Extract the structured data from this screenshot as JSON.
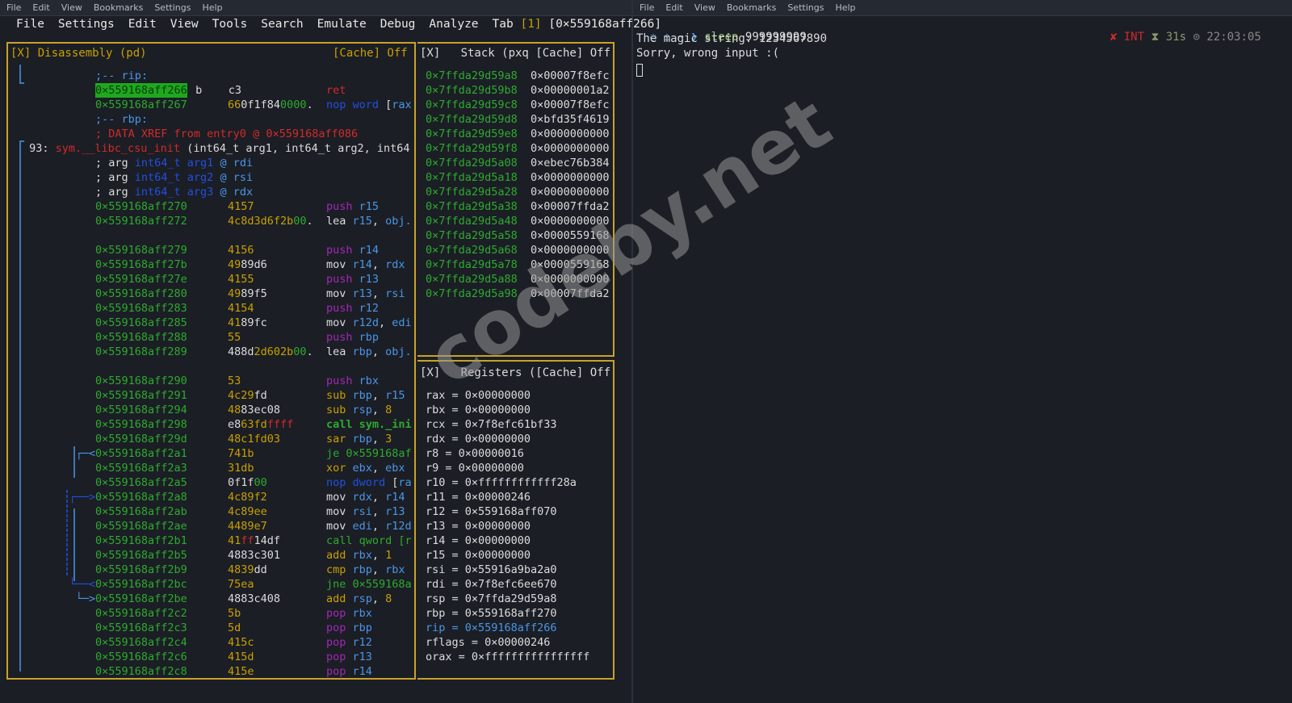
{
  "left_window": {
    "menu": [
      "File",
      "Edit",
      "View",
      "Bookmarks",
      "Settings",
      "Help"
    ]
  },
  "right_window": {
    "menu": [
      "File",
      "Edit",
      "View",
      "Bookmarks",
      "Settings",
      "Help"
    ]
  },
  "r2_menu": {
    "items": [
      "File",
      "Settings",
      "Edit",
      "View",
      "Tools",
      "Search",
      "Emulate",
      "Debug",
      "Analyze"
    ],
    "tab_label": "Tab",
    "tab_num": "[1]",
    "address": "[0×559168aff266]"
  },
  "disasm": {
    "title": "[X] Disassembly (pd)",
    "cache": "[Cache] Off",
    "rows": [
      {
        "c": [
          [
            ";-- rip:",
            "b"
          ]
        ]
      },
      {
        "addr": "0×559168aff266",
        "hl": true,
        "b": [
          [
            " b    c3",
            "w"
          ]
        ],
        "o": [
          [
            "ret",
            "r"
          ]
        ]
      },
      {
        "addr": "0×559168aff267",
        "b": [
          [
            "66",
            "y"
          ],
          [
            "0f1f84",
            "w"
          ],
          [
            "0000",
            "g"
          ],
          [
            ".",
            "w"
          ]
        ],
        "o": [
          [
            "nop word",
            "d"
          ],
          [
            " [",
            "w"
          ],
          [
            "rax",
            "b"
          ]
        ]
      },
      {
        "c": [
          [
            ";-- rbp:",
            "b"
          ]
        ]
      },
      {
        "c": [
          [
            "; DATA XREF from entry0 @ 0×559168aff086",
            "r"
          ]
        ]
      },
      {
        "fn": [
          [
            " 93: ",
            "w"
          ],
          [
            "sym.__libc_csu_init",
            "r"
          ],
          [
            " (int64_t arg1, int64_t arg2, int64",
            "w"
          ]
        ]
      },
      {
        "c": [
          [
            "; arg ",
            "w"
          ],
          [
            "int64_t arg1",
            "d"
          ],
          [
            " @ rdi",
            "b"
          ]
        ]
      },
      {
        "c": [
          [
            "; arg ",
            "w"
          ],
          [
            "int64_t arg2",
            "d"
          ],
          [
            " @ rsi",
            "b"
          ]
        ]
      },
      {
        "c": [
          [
            "; arg ",
            "w"
          ],
          [
            "int64_t arg3",
            "d"
          ],
          [
            " @ rdx",
            "b"
          ]
        ]
      },
      {
        "addr": "0×559168aff270",
        "b": [
          [
            "4157",
            "y"
          ]
        ],
        "o": [
          [
            "push",
            "p"
          ],
          [
            " r15",
            "b"
          ]
        ]
      },
      {
        "addr": "0×559168aff272",
        "b": [
          [
            "4c8d3d6f2b",
            "y"
          ],
          [
            "00",
            "g"
          ],
          [
            ".",
            "w"
          ]
        ],
        "o": [
          [
            "lea ",
            "w"
          ],
          [
            "r15",
            "b"
          ],
          [
            ", ",
            "w"
          ],
          [
            "obj.",
            "b"
          ]
        ]
      },
      {},
      {
        "addr": "0×559168aff279",
        "b": [
          [
            "4156",
            "y"
          ]
        ],
        "o": [
          [
            "push",
            "p"
          ],
          [
            " r14",
            "b"
          ]
        ]
      },
      {
        "addr": "0×559168aff27b",
        "b": [
          [
            "49",
            "y"
          ],
          [
            "89d6",
            "w"
          ]
        ],
        "o": [
          [
            "mov ",
            "w"
          ],
          [
            "r14",
            "b"
          ],
          [
            ", ",
            "w"
          ],
          [
            "rdx",
            "b"
          ]
        ]
      },
      {
        "addr": "0×559168aff27e",
        "b": [
          [
            "4155",
            "y"
          ]
        ],
        "o": [
          [
            "push",
            "p"
          ],
          [
            " r13",
            "b"
          ]
        ]
      },
      {
        "addr": "0×559168aff280",
        "b": [
          [
            "49",
            "y"
          ],
          [
            "89f5",
            "w"
          ]
        ],
        "o": [
          [
            "mov ",
            "w"
          ],
          [
            "r13",
            "b"
          ],
          [
            ", ",
            "w"
          ],
          [
            "rsi",
            "b"
          ]
        ]
      },
      {
        "addr": "0×559168aff283",
        "b": [
          [
            "4154",
            "y"
          ]
        ],
        "o": [
          [
            "push",
            "p"
          ],
          [
            " r12",
            "b"
          ]
        ]
      },
      {
        "addr": "0×559168aff285",
        "b": [
          [
            "41",
            "y"
          ],
          [
            "89fc",
            "w"
          ]
        ],
        "o": [
          [
            "mov ",
            "w"
          ],
          [
            "r12d",
            "b"
          ],
          [
            ", ",
            "w"
          ],
          [
            "edi",
            "b"
          ]
        ]
      },
      {
        "addr": "0×559168aff288",
        "b": [
          [
            "55",
            "y"
          ]
        ],
        "o": [
          [
            "push",
            "p"
          ],
          [
            " rbp",
            "b"
          ]
        ]
      },
      {
        "addr": "0×559168aff289",
        "b": [
          [
            "488d",
            "w"
          ],
          [
            "2d602b",
            "y"
          ],
          [
            "00",
            "g"
          ],
          [
            ".",
            "w"
          ]
        ],
        "o": [
          [
            "lea ",
            "w"
          ],
          [
            "rbp",
            "b"
          ],
          [
            ", ",
            "w"
          ],
          [
            "obj.",
            "b"
          ]
        ]
      },
      {},
      {
        "addr": "0×559168aff290",
        "b": [
          [
            "53",
            "y"
          ]
        ],
        "o": [
          [
            "push",
            "p"
          ],
          [
            " rbx",
            "b"
          ]
        ]
      },
      {
        "addr": "0×559168aff291",
        "b": [
          [
            "4c29",
            "y"
          ],
          [
            "fd",
            "w"
          ]
        ],
        "o": [
          [
            "sub",
            "y"
          ],
          [
            " rbp",
            "b"
          ],
          [
            ", ",
            "w"
          ],
          [
            "r15",
            "b"
          ]
        ]
      },
      {
        "addr": "0×559168aff294",
        "b": [
          [
            "48",
            "y"
          ],
          [
            "83ec08",
            "w"
          ]
        ],
        "o": [
          [
            "sub",
            "y"
          ],
          [
            " rsp",
            "b"
          ],
          [
            ", ",
            "w"
          ],
          [
            "8",
            "y"
          ]
        ]
      },
      {
        "addr": "0×559168aff298",
        "b": [
          [
            "e8",
            "w"
          ],
          [
            "63fd",
            "y"
          ],
          [
            "ffff",
            "r"
          ]
        ],
        "o": [
          [
            "call sym._ini",
            "gb"
          ]
        ]
      },
      {
        "addr": "0×559168aff29d",
        "b": [
          [
            "48c1fd03",
            "y"
          ]
        ],
        "o": [
          [
            "sar",
            "y"
          ],
          [
            " rbp",
            "b"
          ],
          [
            ", ",
            "w"
          ],
          [
            "3",
            "y"
          ]
        ]
      },
      {
        "a": "┌─<",
        "addr": "0×559168aff2a1",
        "b": [
          [
            "741b",
            "y"
          ]
        ],
        "o": [
          [
            "je 0×559168af",
            "g"
          ]
        ]
      },
      {
        "addr": "0×559168aff2a3",
        "b": [
          [
            "31db",
            "y"
          ]
        ],
        "o": [
          [
            "xor",
            "y"
          ],
          [
            " ebx",
            "b"
          ],
          [
            ", ",
            "w"
          ],
          [
            "ebx",
            "b"
          ]
        ]
      },
      {
        "addr": "0×559168aff2a5",
        "b": [
          [
            "0f1f",
            "w"
          ],
          [
            "00",
            "g"
          ]
        ],
        "o": [
          [
            "nop dword",
            "d"
          ],
          [
            " [",
            "w"
          ],
          [
            "ra",
            "b"
          ]
        ]
      },
      {
        "a": "┌──>",
        "addr": "0×559168aff2a8",
        "b": [
          [
            "4c89f2",
            "y"
          ]
        ],
        "o": [
          [
            "mov ",
            "w"
          ],
          [
            "rdx",
            "b"
          ],
          [
            ", ",
            "w"
          ],
          [
            "r14",
            "b"
          ]
        ]
      },
      {
        "addr": "0×559168aff2ab",
        "b": [
          [
            "4c89ee",
            "y"
          ]
        ],
        "o": [
          [
            "mov ",
            "w"
          ],
          [
            "rsi",
            "b"
          ],
          [
            ", ",
            "w"
          ],
          [
            "r13",
            "b"
          ]
        ]
      },
      {
        "addr": "0×559168aff2ae",
        "b": [
          [
            "4489e7",
            "y"
          ]
        ],
        "o": [
          [
            "mov ",
            "w"
          ],
          [
            "edi",
            "b"
          ],
          [
            ", ",
            "w"
          ],
          [
            "r12d",
            "b"
          ]
        ]
      },
      {
        "addr": "0×559168aff2b1",
        "b": [
          [
            "41",
            "y"
          ],
          [
            "ff",
            "r"
          ],
          [
            "14df",
            "w"
          ]
        ],
        "o": [
          [
            "call qword [r",
            "g"
          ]
        ]
      },
      {
        "addr": "0×559168aff2b5",
        "b": [
          [
            "4883c301",
            "w"
          ]
        ],
        "o": [
          [
            "add",
            "y"
          ],
          [
            " rbx",
            "b"
          ],
          [
            ", ",
            "w"
          ],
          [
            "1",
            "y"
          ]
        ]
      },
      {
        "addr": "0×559168aff2b9",
        "b": [
          [
            "4839",
            "y"
          ],
          [
            "dd",
            "w"
          ]
        ],
        "o": [
          [
            "cmp",
            "y"
          ],
          [
            " rbp",
            "b"
          ],
          [
            ", ",
            "w"
          ],
          [
            "rbx",
            "b"
          ]
        ]
      },
      {
        "a": "└──<",
        "addr": "0×559168aff2bc",
        "b": [
          [
            "75ea",
            "y"
          ]
        ],
        "o": [
          [
            "jne 0×559168a",
            "g"
          ]
        ]
      },
      {
        "a": "└─>",
        "addr": "0×559168aff2be",
        "b": [
          [
            "4883c408",
            "w"
          ]
        ],
        "o": [
          [
            "add",
            "y"
          ],
          [
            " rsp",
            "b"
          ],
          [
            ", ",
            "w"
          ],
          [
            "8",
            "y"
          ]
        ]
      },
      {
        "addr": "0×559168aff2c2",
        "b": [
          [
            "5b",
            "y"
          ]
        ],
        "o": [
          [
            "pop",
            "p"
          ],
          [
            " rbx",
            "b"
          ]
        ]
      },
      {
        "addr": "0×559168aff2c3",
        "b": [
          [
            "5d",
            "y"
          ]
        ],
        "o": [
          [
            "pop",
            "p"
          ],
          [
            " rbp",
            "b"
          ]
        ]
      },
      {
        "addr": "0×559168aff2c4",
        "b": [
          [
            "415c",
            "y"
          ]
        ],
        "o": [
          [
            "pop",
            "p"
          ],
          [
            " r12",
            "b"
          ]
        ]
      },
      {
        "addr": "0×559168aff2c6",
        "b": [
          [
            "415d",
            "y"
          ]
        ],
        "o": [
          [
            "pop",
            "p"
          ],
          [
            " r13",
            "b"
          ]
        ]
      },
      {
        "addr": "0×559168aff2c8",
        "b": [
          [
            "415e",
            "y"
          ]
        ],
        "o": [
          [
            "pop",
            "p"
          ],
          [
            " r14",
            "b"
          ]
        ]
      }
    ]
  },
  "stack": {
    "title": "[X]   Stack (pxq [Cache] Off",
    "rows": [
      [
        "0×7ffda29d59a8",
        "0×00007f8efc"
      ],
      [
        "0×7ffda29d59b8",
        "0×00000001a2"
      ],
      [
        "0×7ffda29d59c8",
        "0×00007f8efc"
      ],
      [
        "0×7ffda29d59d8",
        "0×bfd35f4619"
      ],
      [
        "0×7ffda29d59e8",
        "0×0000000000"
      ],
      [
        "0×7ffda29d59f8",
        "0×0000000000"
      ],
      [
        "0×7ffda29d5a08",
        "0×ebec76b384"
      ],
      [
        "0×7ffda29d5a18",
        "0×0000000000"
      ],
      [
        "0×7ffda29d5a28",
        "0×0000000000"
      ],
      [
        "0×7ffda29d5a38",
        "0×00007ffda2"
      ],
      [
        "0×7ffda29d5a48",
        "0×0000000000"
      ],
      [
        "0×7ffda29d5a58",
        "0×0000559168"
      ],
      [
        "0×7ffda29d5a68",
        "0×0000000000"
      ],
      [
        "0×7ffda29d5a78",
        "0×0000559168"
      ],
      [
        "0×7ffda29d5a88",
        "0×0000000000"
      ],
      [
        "0×7ffda29d5a98",
        "0×00007ffda2"
      ]
    ]
  },
  "registers": {
    "title": "[X]   Registers ([Cache] Off",
    "rows": [
      "rax = 0×00000000",
      "rbx = 0×00000000",
      "rcx = 0×7f8efc61bf33",
      "rdx = 0×00000000",
      "r8 = 0×00000016",
      "r9 = 0×00000000",
      "r10 = 0×ffffffffffff28a",
      "r11 = 0×00000246",
      "r12 = 0×559168aff070",
      "r13 = 0×00000000",
      "r14 = 0×00000000",
      "r15 = 0×00000000",
      "rsi = 0×55916a9ba2a0",
      "rdi = 0×7f8efc6ee670",
      "rsp = 0×7ffda29d59a8",
      "rbp = 0×559168aff270",
      "rip = 0×559168aff266",
      "rflags = 0×00000246",
      "orax = 0×ffffffffffffffff"
    ],
    "highlight_index": 16
  },
  "terminal": {
    "prompt_icons": "◌ ⌂ ~ ❯",
    "command": "sleep",
    "arg": "999999999",
    "status_x": "✘",
    "status_int": "INT",
    "duration_icon": "⧗",
    "duration": "31s",
    "clock_icon": "⊙",
    "time": "22:03:05",
    "lines": [
      "The magic string: 1234567890",
      "Sorry, wrong input :("
    ]
  },
  "watermark": "codeby.net"
}
